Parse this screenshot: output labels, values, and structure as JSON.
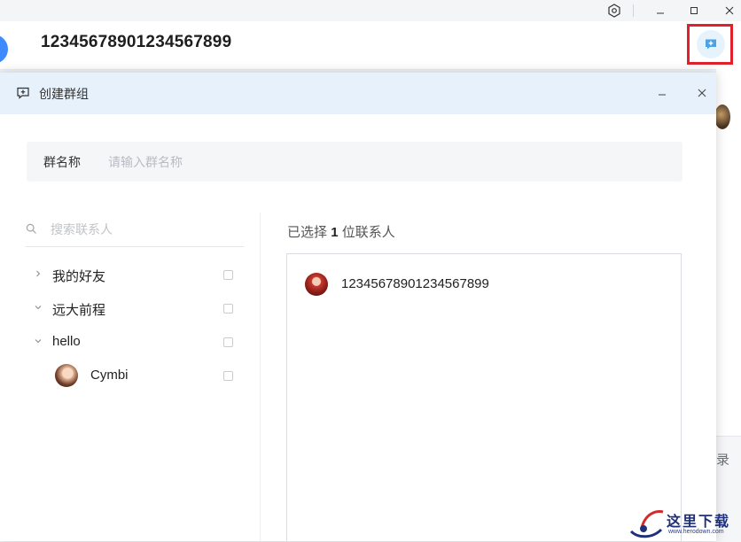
{
  "chat": {
    "title": "12345678901234567899"
  },
  "background": {
    "record_label": "录"
  },
  "dialog": {
    "title": "创建群组",
    "group_name_label": "群名称",
    "group_name_placeholder": "请输入群名称",
    "group_name_value": "",
    "search_placeholder": "搜索联系人",
    "groups": [
      {
        "label": "我的好友",
        "expanded": false,
        "checked": false
      },
      {
        "label": "远大前程",
        "expanded": true,
        "checked": false
      },
      {
        "label": "hello",
        "expanded": true,
        "checked": false
      }
    ],
    "contacts": [
      {
        "label": "Cymbi",
        "group": "hello",
        "checked": false
      }
    ],
    "selected_summary": {
      "prefix": "已选择",
      "count": "1",
      "suffix": "位联系人"
    },
    "selected": [
      {
        "name": "12345678901234567899"
      }
    ]
  },
  "watermark": {
    "text": "这里下载",
    "url": "www.herodown.com"
  },
  "colors": {
    "accent": "#3d8bfd",
    "dialog_header_bg": "#e6f1fc",
    "highlight": "#e0212b"
  }
}
